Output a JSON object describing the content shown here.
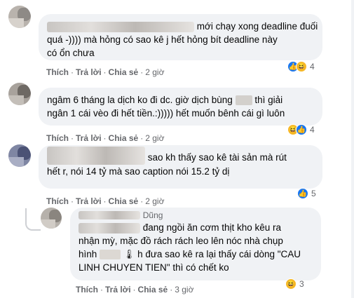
{
  "colors": {
    "bubble": "#f0f2f5",
    "meta": "#65676b",
    "like": "#1877f2",
    "haha": "#f7b928"
  },
  "actions": {
    "like": "Thích",
    "reply": "Trả lời",
    "share": "Chia sẻ"
  },
  "comments": [
    {
      "lines": [
        "mới chạy xong deadline đuối",
        "quá -)))) mà hỏng có sao kê j hết hỏng bít deadline này",
        "có ổn chưa"
      ],
      "time": "2 giờ",
      "reactions": [
        "like-icon",
        "haha-icon"
      ],
      "reaction_count": "4"
    },
    {
      "lines": [
        "ngâm 6 tháng la dịch ko đi dc. giờ dịch bùng",
        "thì giải",
        "ngân 1 cái vèo đi hết tiền.:))))) hết muốn bênh cái gì luôn"
      ],
      "time": "2 giờ",
      "reactions": [
        "haha-icon",
        "like-icon"
      ],
      "reaction_count": "4"
    },
    {
      "lines": [
        "sao kh thấy sao kê tài sản mà rút",
        "hết r, nói 14 tỷ mà sao caption nói 15.2 tỷ dị"
      ],
      "time": "2 giờ",
      "reactions": [
        "like-icon"
      ],
      "reaction_count": "5"
    },
    {
      "lines": [
        "Dũng",
        "đang ngồi ăn cơm thịt kho kêu ra",
        "nhận mỳ, mặc đồ rách rách leo lên nóc nhà chụp",
        "hình",
        "h đưa sao kê ra lại thấy cái dòng \"CAU",
        "LINH CHUYEN TIEN\" thì có chết ko"
      ],
      "time": "3 giờ",
      "reactions": [
        "haha-icon"
      ],
      "reaction_count": "3"
    }
  ]
}
